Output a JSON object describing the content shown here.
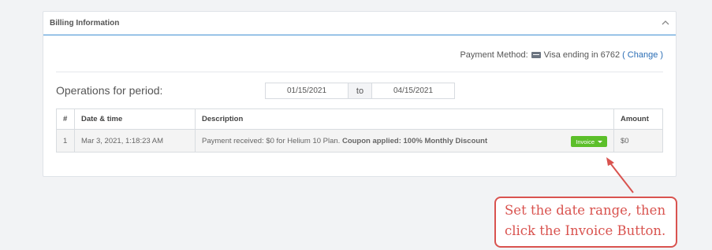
{
  "panel": {
    "title": "Billing Information",
    "collapse_icon": "chevron-up-icon"
  },
  "payment": {
    "label": "Payment Method:",
    "card_icon": "credit-card-icon",
    "card_text": "Visa ending in 6762",
    "open_paren": "(",
    "change_label": "Change",
    "close_paren": ")"
  },
  "period": {
    "label": "Operations for period:",
    "start_date": "01/15/2021",
    "separator": "to",
    "end_date": "04/15/2021"
  },
  "table": {
    "headers": [
      "#",
      "Date & time",
      "Description",
      "Amount"
    ],
    "rows": [
      {
        "num": "1",
        "datetime": "Mar 3, 2021, 1:18:23 AM",
        "description": "Payment received: $0 for Helium 10 Plan. ",
        "description_bold": "Coupon applied: 100% Monthly Discount",
        "action_label": "Invoice",
        "amount": "$0"
      }
    ]
  },
  "callout": {
    "line1": "Set the date range, then",
    "line2": "click the Invoice Button.",
    "color": "#d9534f"
  },
  "colors": {
    "accent_line": "#3f8fd3",
    "invoice_button": "#5cbf2a",
    "link": "#2a6db5"
  }
}
